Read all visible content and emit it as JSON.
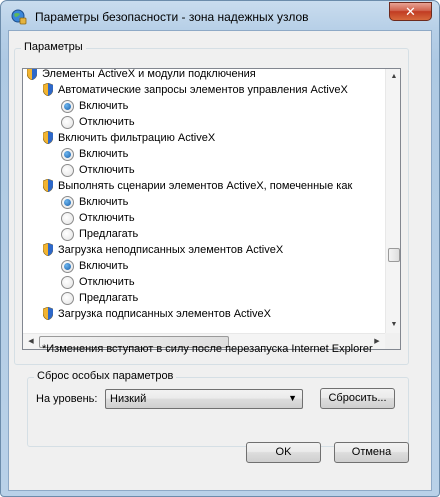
{
  "window": {
    "title": "Параметры безопасности - зона надежных узлов",
    "close_label": "✕"
  },
  "settings_group": {
    "title": "Параметры",
    "rows": [
      {
        "kind": "category",
        "text": "Элементы ActiveX и модули подключения"
      },
      {
        "kind": "setting",
        "text": "Автоматические запросы элементов управления ActiveX"
      },
      {
        "kind": "option",
        "text": "Включить",
        "checked": true
      },
      {
        "kind": "option",
        "text": "Отключить",
        "checked": false
      },
      {
        "kind": "setting",
        "text": "Включить фильтрацию ActiveX"
      },
      {
        "kind": "option",
        "text": "Включить",
        "checked": true
      },
      {
        "kind": "option",
        "text": "Отключить",
        "checked": false
      },
      {
        "kind": "setting",
        "text": "Выполнять сценарии элементов ActiveX, помеченные как"
      },
      {
        "kind": "option",
        "text": "Включить",
        "checked": true
      },
      {
        "kind": "option",
        "text": "Отключить",
        "checked": false
      },
      {
        "kind": "option",
        "text": "Предлагать",
        "checked": false
      },
      {
        "kind": "setting",
        "text": "Загрузка неподписанных элементов ActiveX"
      },
      {
        "kind": "option",
        "text": "Включить",
        "checked": true
      },
      {
        "kind": "option",
        "text": "Отключить",
        "checked": false
      },
      {
        "kind": "option",
        "text": "Предлагать",
        "checked": false
      },
      {
        "kind": "setting",
        "text": "Загрузка подписанных элементов ActiveX"
      }
    ],
    "note": "*Изменения вступают в силу после перезапуска Internet Explorer"
  },
  "reset_group": {
    "title": "Сброс особых параметров",
    "level_label": "На уровень:",
    "level_value": "Низкий",
    "reset_button": "Сбросить..."
  },
  "footer": {
    "ok_button": "OK",
    "cancel_button": "Отмена"
  },
  "icons": {
    "title": "security-globe-icon",
    "row": "shield-icon",
    "scroll_up": "▲",
    "scroll_down": "▼",
    "scroll_left": "◀",
    "scroll_right": "▶",
    "dropdown": "▼"
  },
  "colors": {
    "accent": "#1a5fa8",
    "shield_gold": "#f2b431",
    "shield_blue": "#2e68c8"
  }
}
